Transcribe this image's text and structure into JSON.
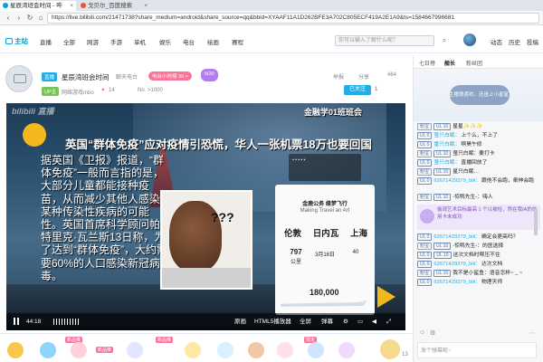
{
  "browser": {
    "tabs": [
      {
        "title": "星辰湾班会时间 - 哔",
        "active": true
      },
      {
        "title": "戈贝尔_百度搜索",
        "active": false
      }
    ],
    "url": "https://live.bilibili.com/21471738?share_medium=android&share_source=qq&bbid=XYAAF11A1D262BFE3A702C805ECF419A2E1A9&ts=1584667996681"
  },
  "site_nav": {
    "logo": "主站",
    "items": [
      "直播",
      "全部",
      "网游",
      "手游",
      "单机",
      "娱乐",
      "电台",
      "绘画",
      "赛程"
    ],
    "search_placeholder": "你可以输入了解什么呢？",
    "right_items": [
      "动态",
      "历史",
      "投稿"
    ]
  },
  "room": {
    "tags": [
      "直播",
      "UP主"
    ],
    "title": "星辰湾班会时间",
    "area": "聊天电台",
    "badge_rank": "电台小时榜 30 >",
    "badge_count": "0/30",
    "area2": "网络游戏mbo",
    "likes": "14",
    "rank": "No. >1000",
    "actions": [
      "举报",
      "分享",
      "464"
    ],
    "follow_label": "已关注",
    "follow_count": "1"
  },
  "video": {
    "watermark": "bilibili 直播",
    "headline": "英国“群体免疫”应对疫情引恐慌，华人一张机票18万也要回国",
    "body": "据英国《卫报》报道，“群体免疫”一般而言指的是，大部分儿童都能接种疫苗，从而减少其他人感染某种传染性疾病的可能性。英国首席科学顾问帕特里克·瓦兰斯13日称，为了达到“群体免疫”，大约需要60%的人口感染新冠病毒。",
    "meme_text": "???",
    "top_overlay": "金融学01班班会",
    "ticket": {
      "header": "金鹿公务 缘梦飞行",
      "sub": "Making Travel an Art",
      "cities": [
        "伦敦",
        "日内瓦",
        "上海"
      ],
      "km": "797",
      "unit": "公里",
      "date": "3月16日",
      "seats": "40",
      "price": "180,000"
    },
    "controls": {
      "time": "44:18",
      "right": [
        "原画",
        "HTML5播放器",
        "全屏",
        "弹幕"
      ]
    }
  },
  "gifts": {
    "badges": [
      "新品推",
      "新品推",
      "新品推",
      "限定"
    ],
    "count": "13"
  },
  "chat": {
    "tabs": [
      "七日榜",
      "舰长",
      "粉丝团"
    ],
    "banner_text": "主播很喜欢，还送上小星星",
    "messages": [
      {
        "medal": "粉宝",
        "level": "UL 10",
        "user": "",
        "text": "星星✨✨✨"
      },
      {
        "medal": "UL 0",
        "level": "",
        "user": "萤只白眠：",
        "text": "上个么，不上了"
      },
      {
        "medal": "UL 0",
        "level": "",
        "user": "雷只白眠：",
        "text": "啊昊午修"
      },
      {
        "medal": "粉宝",
        "level": "UL 10",
        "user": "",
        "text": "萤只白眠：要打卡"
      },
      {
        "medal": "UL 0",
        "level": "",
        "user": "萤只白眠：",
        "text": "直播回放了"
      },
      {
        "medal": "粉宝",
        "level": "UL 10",
        "user": "",
        "text": "星只白眠…"
      },
      {
        "medal": "UL 0",
        "level": "",
        "user": "62671429379_bili：",
        "text": "跟他不会跑，牵伸会跑"
      },
      {
        "medal": "粉宝",
        "level": "UL 10",
        "user": "",
        "text": "-惊鸭先生-：嗨人"
      },
      {
        "medal": "UL 0",
        "level": "",
        "user": "62671429379_bili：",
        "text": "确定会更高吗？"
      },
      {
        "medal": "粉宝",
        "level": "UL 10",
        "user": "",
        "text": "-惊鸭先生-：的医选择"
      },
      {
        "medal": "UL 0",
        "level": "UL 10",
        "user": "",
        "text": "这次文档时帮压不住"
      },
      {
        "medal": "UL 0",
        "level": "",
        "user": "62671429379_bili：",
        "text": "达次文档"
      },
      {
        "medal": "粉宝",
        "level": "UL 10",
        "user": "",
        "text": "我不是小鲨鱼：语音怎样~ _ ~"
      },
      {
        "medal": "UL 0",
        "level": "",
        "user": "62671429379_bili：",
        "text": "物理天师"
      }
    ],
    "gift_notice": "偷观艺术目标最高 1 个以被检，然在我IA的信用卡未成功",
    "input_placeholder": "发个弹幕呢~"
  }
}
